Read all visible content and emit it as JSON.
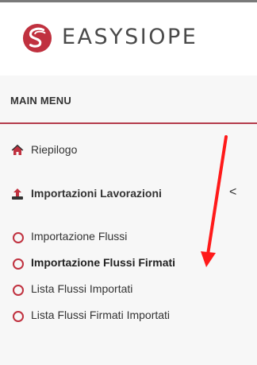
{
  "brand": {
    "name": "EASYSIOPE",
    "logo_icon": "easysiope-logo-icon",
    "accent_color": "#c0313f"
  },
  "menu": {
    "header": "MAIN MENU",
    "items": [
      {
        "label": "Riepilogo",
        "icon": "home-icon"
      },
      {
        "label": "Importazioni Lavorazioni",
        "icon": "upload-icon",
        "chevron": "<",
        "expanded": true
      }
    ],
    "submenu": [
      {
        "label": "Importazione Flussi"
      },
      {
        "label": "Importazione Flussi Firmati",
        "active": true
      },
      {
        "label": "Lista Flussi Importati"
      },
      {
        "label": "Lista Flussi Firmati Importati"
      }
    ]
  },
  "annotation": {
    "arrow_color": "#ff1a1a"
  }
}
